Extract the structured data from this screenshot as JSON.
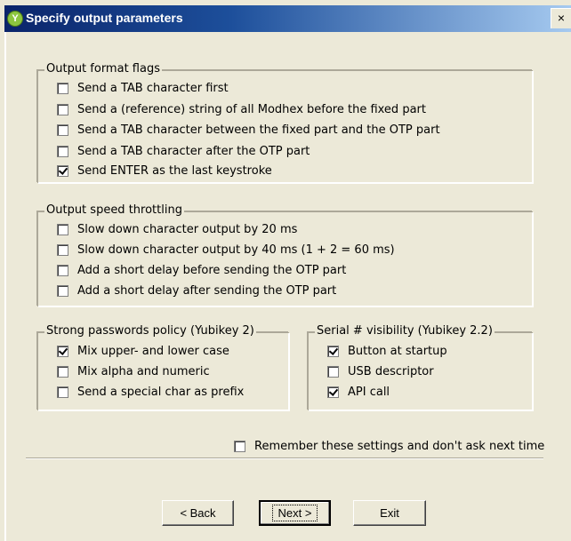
{
  "window": {
    "title": "Specify output parameters",
    "app_icon_glyph": "Y",
    "close_glyph": "×"
  },
  "output_format": {
    "legend": "Output format flags",
    "items": [
      {
        "label": "Send a TAB character first",
        "checked": false
      },
      {
        "label": "Send a (reference) string of all Modhex before the fixed part",
        "checked": false
      },
      {
        "label": "Send a TAB character between the fixed part and the OTP part",
        "checked": false
      },
      {
        "label": "Send a TAB character after the OTP part",
        "checked": false
      },
      {
        "label": "Send ENTER as the last keystroke",
        "checked": true
      }
    ]
  },
  "speed": {
    "legend": "Output speed throttling",
    "items": [
      {
        "label": "Slow down character output by 20 ms",
        "checked": false
      },
      {
        "label": "Slow down character output by 40 ms (1 + 2 = 60 ms)",
        "checked": false
      },
      {
        "label": "Add a short delay before sending the OTP part",
        "checked": false
      },
      {
        "label": "Add a short delay after sending the OTP part",
        "checked": false
      }
    ]
  },
  "strong_passwords": {
    "legend": "Strong passwords policy (Yubikey 2)",
    "items": [
      {
        "label": "Mix upper- and lower case",
        "checked": true
      },
      {
        "label": "Mix alpha and numeric",
        "checked": false
      },
      {
        "label": "Send a special char as prefix",
        "checked": false
      }
    ]
  },
  "serial": {
    "legend": "Serial # visibility (Yubikey 2.2)",
    "items": [
      {
        "label": "Button at startup",
        "checked": true
      },
      {
        "label": "USB descriptor",
        "checked": false
      },
      {
        "label": "API call",
        "checked": true
      }
    ]
  },
  "remember": {
    "label": "Remember these settings and don't ask next time",
    "checked": false
  },
  "buttons": {
    "back": "< Back",
    "next": "Next >",
    "exit": "Exit"
  },
  "colors": {
    "title_start": "#0a246a",
    "title_end": "#a6caf0",
    "face": "#ece9d8"
  }
}
